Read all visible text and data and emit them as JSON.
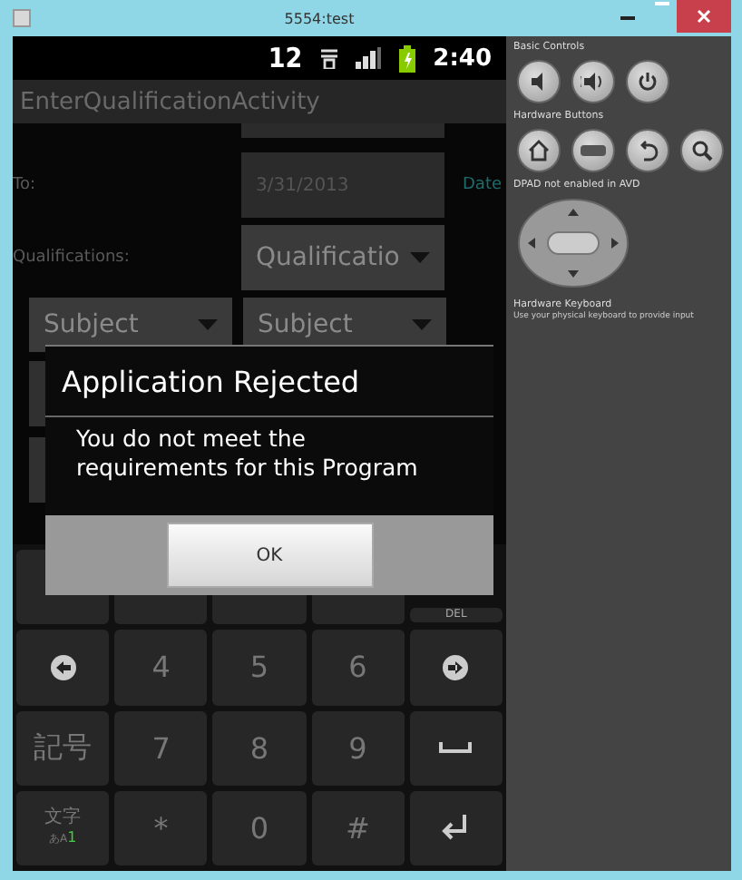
{
  "window": {
    "title": "5554:test"
  },
  "status_bar": {
    "notification": "12",
    "time": "2:40"
  },
  "app_bar": {
    "title": "EnterQualificationActivity"
  },
  "form": {
    "to_label": "To:",
    "to_value": "3/31/2013",
    "date_link": "Date",
    "qualifications_label": "Qualifications:",
    "qualification_spinner": "Qualificatio",
    "subject_spinners": [
      "Subject",
      "Subject"
    ]
  },
  "dialog": {
    "title": "Application Rejected",
    "message": "You do not meet the requirements for this Program",
    "button": "OK"
  },
  "keyboard": {
    "rows": [
      [
        {
          "kind": "blank"
        },
        {
          "kind": "blank"
        },
        {
          "kind": "blank"
        },
        {
          "kind": "blank"
        },
        {
          "kind": "small",
          "label": "DEL"
        }
      ],
      [
        {
          "kind": "left"
        },
        {
          "kind": "text",
          "label": "4"
        },
        {
          "kind": "text",
          "label": "5"
        },
        {
          "kind": "text",
          "label": "6"
        },
        {
          "kind": "right"
        }
      ],
      [
        {
          "kind": "text",
          "label": "記号"
        },
        {
          "kind": "text",
          "label": "7"
        },
        {
          "kind": "text",
          "label": "8"
        },
        {
          "kind": "text",
          "label": "9"
        },
        {
          "kind": "space"
        }
      ],
      [
        {
          "kind": "mode",
          "label": "文字",
          "sub": "あA",
          "accent": "1"
        },
        {
          "kind": "text",
          "label": "*"
        },
        {
          "kind": "text",
          "label": "0"
        },
        {
          "kind": "text",
          "label": "#"
        },
        {
          "kind": "enter"
        }
      ]
    ]
  },
  "side_panel": {
    "basic_controls": "Basic Controls",
    "hardware_buttons": "Hardware Buttons",
    "dpad_note": "DPAD not enabled in AVD",
    "keyboard_title": "Hardware Keyboard",
    "keyboard_note": "Use your physical keyboard to provide input"
  }
}
